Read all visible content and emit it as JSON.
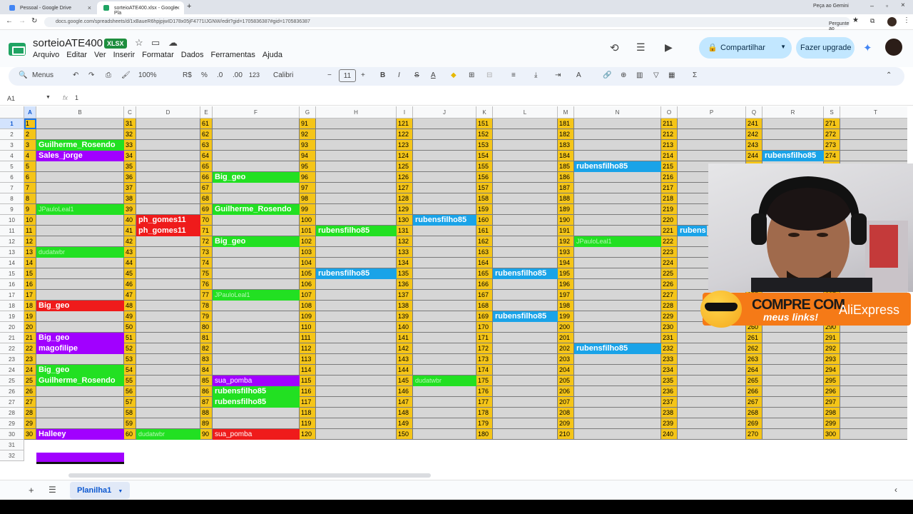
{
  "browser": {
    "tabs": [
      {
        "title": "Pessoal - Google Drive",
        "active": false,
        "favicon_color": "#4285f4"
      },
      {
        "title": "sorteioATE400.xlsx - Google Pla",
        "active": true,
        "favicon_color": "#1fa463"
      }
    ],
    "new_tab": "+",
    "url": "docs.google.com/spreadsheets/d/1xBaueR6hpjpjwID178x05jF4771IJGNW/edit?gid=1705836387#gid=1705836387",
    "profile": "Peça ao Gemini",
    "ask_google": "Pergunte ao Google"
  },
  "app": {
    "title": "sorteioATE400",
    "badge": "XLSX",
    "menus": [
      "Arquivo",
      "Editar",
      "Ver",
      "Inserir",
      "Formatar",
      "Dados",
      "Ferramentas",
      "Ajuda"
    ],
    "share_label": "Compartilhar",
    "upgrade_label": "Fazer upgrade"
  },
  "toolbar": {
    "menus_label": "Menus",
    "zoom": "100%",
    "currency": "R$",
    "percent": "%",
    "dec_less": ".0",
    "dec_more": ".00",
    "number_format": "123",
    "font": "Calibri",
    "font_size": "11",
    "bold": "B",
    "italic": "I",
    "strike": "S",
    "text_color": "A",
    "sum": "Σ"
  },
  "formula_bar": {
    "cell_ref": "A1",
    "fx": "fx",
    "value": "1"
  },
  "columns": [
    "A",
    "B",
    "C",
    "D",
    "E",
    "F",
    "G",
    "H",
    "I",
    "J",
    "K",
    "L",
    "M",
    "N",
    "O",
    "P",
    "Q",
    "R",
    "S",
    "T"
  ],
  "row_count": 32,
  "names": [
    {
      "col": "B",
      "row": 3,
      "text": "Guilherme_Rosendo",
      "bg": "green"
    },
    {
      "col": "B",
      "row": 4,
      "text": "Sales_jorge",
      "bg": "purple"
    },
    {
      "col": "B",
      "row": 9,
      "text": "JPauloLeal1",
      "bg": "green",
      "light": true
    },
    {
      "col": "B",
      "row": 13,
      "text": "dudatwbr",
      "bg": "green",
      "light": true
    },
    {
      "col": "B",
      "row": 18,
      "text": "Big_geo",
      "bg": "red"
    },
    {
      "col": "B",
      "row": 21,
      "text": "Big_geo",
      "bg": "purple"
    },
    {
      "col": "B",
      "row": 22,
      "text": "magofilipe",
      "bg": "purple"
    },
    {
      "col": "B",
      "row": 24,
      "text": "Big_geo",
      "bg": "green"
    },
    {
      "col": "B",
      "row": 25,
      "text": "Guilherme_Rosendo",
      "bg": "green"
    },
    {
      "col": "B",
      "row": 30,
      "text": "Halleey",
      "bg": "purple"
    },
    {
      "col": "D",
      "row": 10,
      "text": "ph_gomes11",
      "bg": "red"
    },
    {
      "col": "D",
      "row": 11,
      "text": "ph_gomes11",
      "bg": "red"
    },
    {
      "col": "D",
      "row": 30,
      "text": "dudatwbr",
      "bg": "green",
      "light": true
    },
    {
      "col": "F",
      "row": 6,
      "text": "Big_geo",
      "bg": "green"
    },
    {
      "col": "F",
      "row": 9,
      "text": "Guilherme_Rosendo",
      "bg": "green"
    },
    {
      "col": "F",
      "row": 12,
      "text": "Big_geo",
      "bg": "green"
    },
    {
      "col": "F",
      "row": 17,
      "text": "JPauloLeal1",
      "bg": "green",
      "light": true
    },
    {
      "col": "F",
      "row": 25,
      "text": "sua_pomba",
      "bg": "purple",
      "normal": true
    },
    {
      "col": "F",
      "row": 26,
      "text": "rubensfilho85",
      "bg": "green"
    },
    {
      "col": "F",
      "row": 27,
      "text": "rubensfilho85",
      "bg": "green"
    },
    {
      "col": "F",
      "row": 30,
      "text": "sua_pomba",
      "bg": "red",
      "normal": true
    },
    {
      "col": "H",
      "row": 11,
      "text": "rubensfilho85",
      "bg": "green"
    },
    {
      "col": "H",
      "row": 15,
      "text": "rubensfilho85",
      "bg": "blue"
    },
    {
      "col": "J",
      "row": 10,
      "text": "rubensfilho85",
      "bg": "blue"
    },
    {
      "col": "J",
      "row": 25,
      "text": "dudatwbr",
      "bg": "green",
      "light": true
    },
    {
      "col": "L",
      "row": 15,
      "text": "rubensfilho85",
      "bg": "blue"
    },
    {
      "col": "L",
      "row": 19,
      "text": "rubensfilho85",
      "bg": "blue"
    },
    {
      "col": "N",
      "row": 5,
      "text": "rubensfilho85",
      "bg": "blue"
    },
    {
      "col": "N",
      "row": 12,
      "text": "JPauloLeal1",
      "bg": "green",
      "light": true
    },
    {
      "col": "N",
      "row": 22,
      "text": "rubensfilho85",
      "bg": "blue"
    },
    {
      "col": "P",
      "row": 11,
      "text": "rubens",
      "bg": "blue"
    },
    {
      "col": "R",
      "row": 4,
      "text": "rubensfilho85",
      "bg": "blue"
    }
  ],
  "colors": {
    "yellow": "#f5c518",
    "gray": "#d6d6d6",
    "green": "#22e022",
    "purple": "#a100ff",
    "red": "#ef1b1b",
    "blue": "#1aa3e8"
  },
  "overlay": {
    "promo_line1": "COMPRE COM",
    "promo_line2": "meus links!",
    "promo_brand": "AliExpress"
  },
  "sheet": {
    "tab_label": "Planilha1"
  }
}
